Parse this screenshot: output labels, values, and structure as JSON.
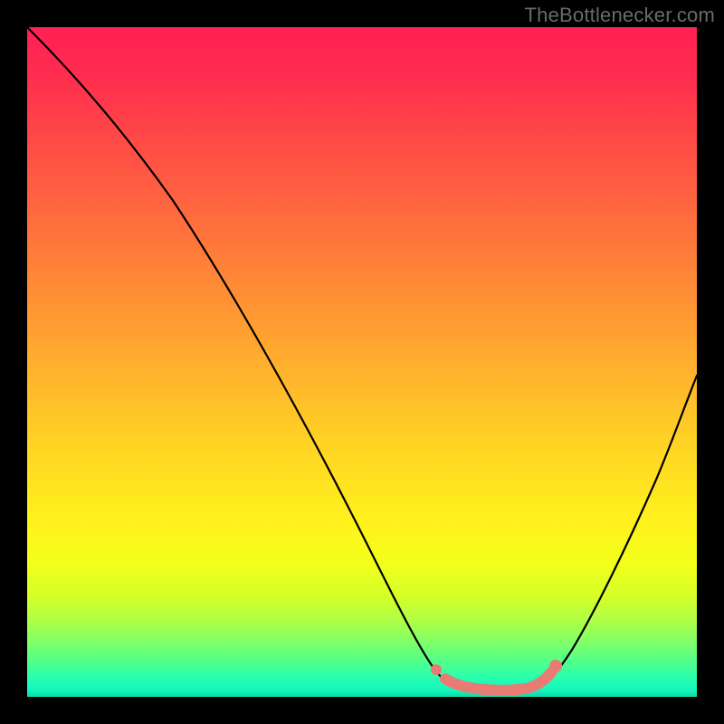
{
  "watermark": "TheBottlenecker.com",
  "chart_data": {
    "type": "line",
    "title": "",
    "xlabel": "",
    "ylabel": "",
    "xlim": [
      0,
      1
    ],
    "ylim": [
      0,
      1
    ],
    "series": [
      {
        "name": "bottleneck-curve",
        "x": [
          0.0,
          0.05,
          0.1,
          0.15,
          0.2,
          0.25,
          0.3,
          0.35,
          0.4,
          0.45,
          0.5,
          0.55,
          0.6,
          0.63,
          0.67,
          0.73,
          0.78,
          0.82,
          0.86,
          0.9,
          0.95,
          1.0
        ],
        "y": [
          1.0,
          0.93,
          0.86,
          0.79,
          0.71,
          0.63,
          0.55,
          0.47,
          0.38,
          0.29,
          0.2,
          0.12,
          0.05,
          0.02,
          0.0,
          0.0,
          0.02,
          0.06,
          0.13,
          0.22,
          0.34,
          0.48
        ]
      }
    ],
    "highlight": {
      "name": "optimal-region",
      "x": [
        0.6,
        0.63,
        0.67,
        0.73,
        0.78
      ],
      "y": [
        0.05,
        0.02,
        0.0,
        0.0,
        0.02
      ]
    },
    "gradient_stops": [
      {
        "pos": 0.0,
        "color": "#ff1f54"
      },
      {
        "pos": 0.5,
        "color": "#ffc020"
      },
      {
        "pos": 0.8,
        "color": "#f3ff1a"
      },
      {
        "pos": 1.0,
        "color": "#0cd9a8"
      }
    ]
  }
}
